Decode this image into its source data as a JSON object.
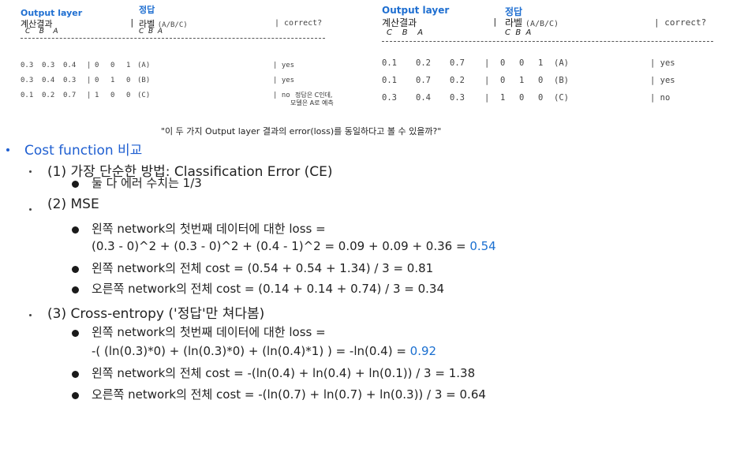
{
  "left_table": {
    "title": "Output layer",
    "answer_header": "정답",
    "calc_header": "계산결과",
    "label_header": "라벨",
    "label_abc": "(A/B/C)",
    "correct_header": "| correct?",
    "cols_out": "C    B    A",
    "cols_lbl": "C  B  A",
    "rows": [
      {
        "out": [
          "0.3",
          "0.3",
          "0.4"
        ],
        "lbl": [
          "0",
          "0",
          "1",
          "(A)"
        ],
        "correct": "| yes"
      },
      {
        "out": [
          "0.3",
          "0.4",
          "0.3"
        ],
        "lbl": [
          "0",
          "1",
          "0",
          "(B)"
        ],
        "correct": "| yes"
      },
      {
        "out": [
          "0.1",
          "0.2",
          "0.7"
        ],
        "lbl": [
          "1",
          "0",
          "0",
          "(C)"
        ],
        "correct": "| no"
      }
    ],
    "note_line1": "정답은 C인데,",
    "note_line2": "모델은 A로 예측"
  },
  "right_table": {
    "title": "Output layer",
    "answer_header": "정답",
    "calc_header": "계산결과",
    "label_header": "라벨",
    "label_abc": "(A/B/C)",
    "correct_header": "| correct?",
    "cols_out": "C    B    A",
    "cols_lbl": "C  B  A",
    "rows": [
      {
        "out": [
          "0.1",
          "0.2",
          "0.7"
        ],
        "lbl": [
          "0",
          "0",
          "1",
          "(A)"
        ],
        "correct": "| yes"
      },
      {
        "out": [
          "0.1",
          "0.7",
          "0.2"
        ],
        "lbl": [
          "0",
          "1",
          "0",
          "(B)"
        ],
        "correct": "| yes"
      },
      {
        "out": [
          "0.3",
          "0.4",
          "0.3"
        ],
        "lbl": [
          "1",
          "0",
          "0",
          "(C)"
        ],
        "correct": "| no"
      }
    ]
  },
  "question": "\"이 두 가지 Output layer 결과의 error(loss)를 동일하다고 볼 수 있을까?\"",
  "outline": {
    "heading": "Cost function 비교",
    "ce_title": "(1) 가장 단순한 방법: Classification Error (CE)",
    "ce_item": "둘 다 에러 수치는 1/3",
    "mse_title": "(2) MSE",
    "mse_item1_line1": "왼쪽 network의 첫번째 데이터에 대한 loss =",
    "mse_item1_line2": "(0.3 - 0)^2 + (0.3 - 0)^2 + (0.4 - 1)^2 = 0.09 + 0.09 + 0.36 = ",
    "mse_item1_value": "0.54",
    "mse_item2": "왼쪽 network의 전체 cost = (0.54 + 0.54 + 1.34) / 3 = 0.81",
    "mse_item3": "오른쪽 network의 전체 cost = (0.14 + 0.14 + 0.74) / 3 = 0.34",
    "ce2_title": "(3) Cross-entropy ('정답'만 쳐다봄)",
    "ce2_item1_line1": "왼쪽 network의 첫번째 데이터에 대한 loss =",
    "ce2_item1_line2": "-( (ln(0.3)*0) + (ln(0.3)*0) + (ln(0.4)*1) ) = -ln(0.4) = ",
    "ce2_item1_value": "0.92",
    "ce2_item2": "왼쪽 network의 전체 cost = -(ln(0.4) + ln(0.4) + ln(0.1)) / 3 = 1.38",
    "ce2_item3": "오른쪽 network의 전체 cost = -(ln(0.7) + ln(0.7) + ln(0.3)) / 3 = 0.64"
  }
}
